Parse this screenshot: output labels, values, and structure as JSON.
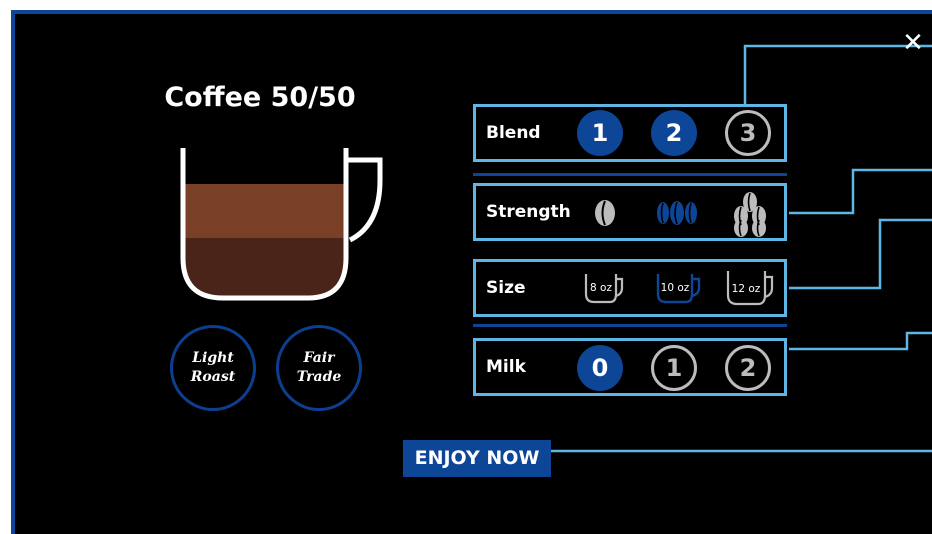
{
  "close_label": "✕",
  "product": {
    "title": "Coffee 50/50",
    "badges": [
      "Light\nRoast",
      "Fair\nTrade"
    ]
  },
  "options": {
    "blend": {
      "label": "Blend",
      "choices": [
        "1",
        "2",
        "3"
      ],
      "selected": [
        0,
        1
      ]
    },
    "strength": {
      "label": "Strength",
      "choices": [
        "mild-bean-icon",
        "medium-bean-icon",
        "strong-bean-icon"
      ],
      "selected": 1
    },
    "size": {
      "label": "Size",
      "choices": [
        "8 oz",
        "10 oz",
        "12 oz"
      ],
      "selected": 1
    },
    "milk": {
      "label": "Milk",
      "choices": [
        "0",
        "1",
        "2"
      ],
      "selected": 0
    }
  },
  "action": {
    "enjoy_label": "ENJOY NOW"
  },
  "colors": {
    "accent_blue": "#0d4597",
    "outline_cyan": "#5fb6e4",
    "inactive_gray": "#bcbcbc",
    "coffee_light": "#7a3f27",
    "coffee_dark": "#4a2418"
  }
}
